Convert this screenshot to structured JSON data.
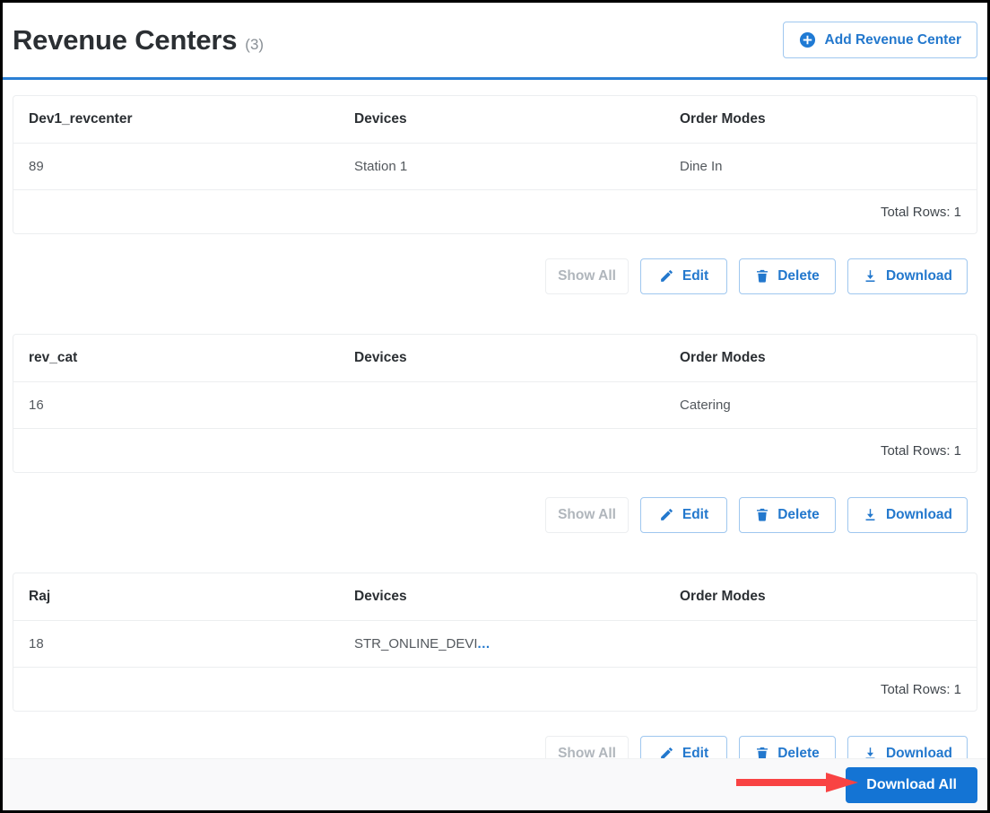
{
  "header": {
    "title": "Revenue Centers",
    "count": "(3)",
    "add_button_label": "Add Revenue Center",
    "add_button_icon": "plus-circle-icon",
    "accent_color": "#2a7fd4",
    "link_color": "#2378cd"
  },
  "columns": {
    "devices": "Devices",
    "order_modes": "Order Modes"
  },
  "actions": {
    "show_all": "Show All",
    "edit": "Edit",
    "delete": "Delete",
    "download": "Download",
    "icons": {
      "edit": "pencil-icon",
      "delete": "trash-icon",
      "download": "download-icon"
    }
  },
  "sections": [
    {
      "name": "Dev1_revcenter",
      "row": {
        "id": "89",
        "devices": "Station 1",
        "devices_truncated": false,
        "order_modes": "Dine In"
      },
      "total_rows": "Total Rows: 1"
    },
    {
      "name": "rev_cat",
      "row": {
        "id": "16",
        "devices": "",
        "devices_truncated": false,
        "order_modes": "Catering"
      },
      "total_rows": "Total Rows: 1"
    },
    {
      "name": "Raj",
      "row": {
        "id": "18",
        "devices": "STR_ONLINE_DEVI",
        "devices_truncated": true,
        "order_modes": ""
      },
      "total_rows": "Total Rows: 1"
    }
  ],
  "truncation_indicator": "...",
  "footer": {
    "download_all_label": "Download All",
    "button_color": "#1474d4"
  },
  "annotation": {
    "type": "arrow",
    "direction": "right",
    "color": "#f94343",
    "points_to": "Download All"
  }
}
